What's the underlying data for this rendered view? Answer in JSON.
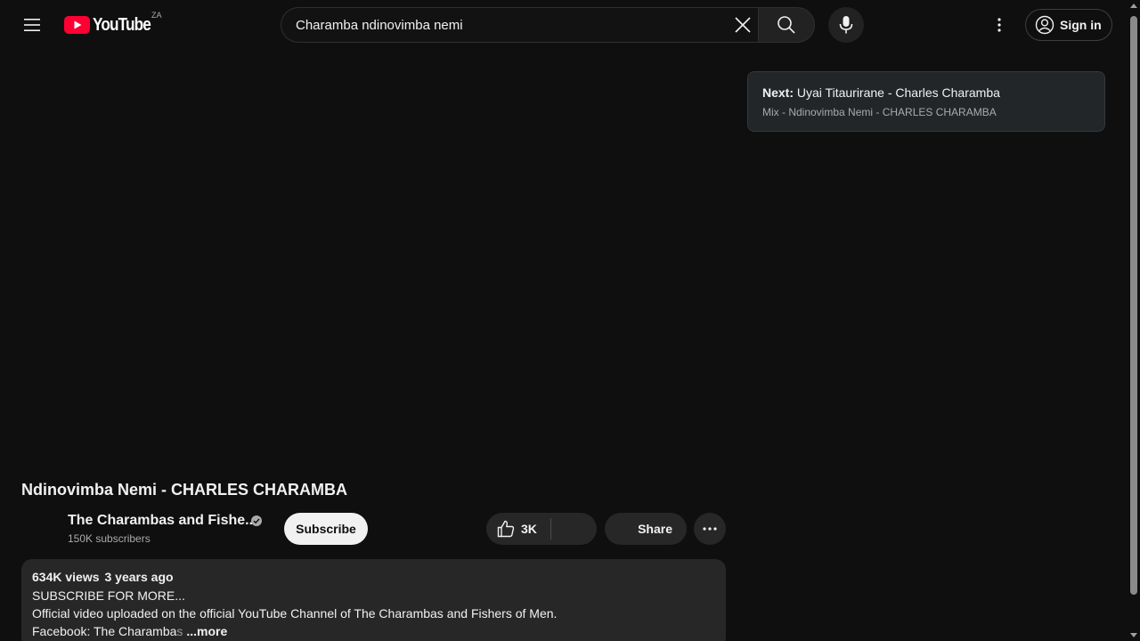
{
  "header": {
    "logo_text": "YouTube",
    "country_code": "ZA",
    "search": {
      "value": "Charamba ndinovimba nemi",
      "placeholder": "Search"
    },
    "sign_in_label": "Sign in"
  },
  "up_next": {
    "prefix": "Next:",
    "title": "Uyai Titaurirane - Charles Charamba",
    "playlist": "Mix - Ndinovimba Nemi - CHARLES CHARAMBA"
  },
  "video": {
    "title": "Ndinovimba Nemi - CHARLES CHARAMBA",
    "channel_name": "The Charambas and Fishe...",
    "subscribers": "150K subscribers",
    "subscribe_label": "Subscribe",
    "like_count": "3K",
    "share_label": "Share"
  },
  "description": {
    "views": "634K views",
    "age": "3 years ago",
    "line1": "SUBSCRIBE FOR MORE...",
    "line2": "Official video uploaded on the official YouTube Channel of The Charambas and Fishers of Men.",
    "line3_start": "Facebook: The Charamba",
    "line3_fade": "s",
    "more_label": "...more"
  },
  "colors": {
    "background": "#0f0f0f",
    "brand_red": "#ff0033",
    "subscribe_bg": "#f1f1f1",
    "pill_bg": "#272727",
    "upnext_bg": "#222629"
  },
  "icons": [
    "menu-icon",
    "youtube-play-icon",
    "clear-icon",
    "search-icon",
    "mic-icon",
    "more-vert-icon",
    "account-icon",
    "verified-icon",
    "thumb-up-icon",
    "more-horiz-icon"
  ]
}
